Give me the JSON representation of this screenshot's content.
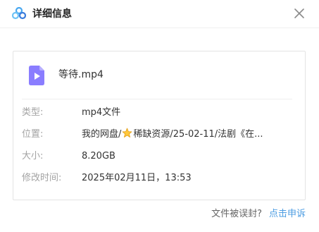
{
  "dialog": {
    "title": "详细信息",
    "logo_icon": "cloud-logo-icon",
    "close_icon": "close-icon"
  },
  "file": {
    "name": "等待.mp4",
    "icon": "video-file-icon",
    "icon_color": "#8a7dff"
  },
  "details": {
    "type_label": "类型:",
    "type_value": "mp4文件",
    "location_label": "位置:",
    "location_prefix": "我的网盘/",
    "location_icon": "star-icon",
    "location_suffix": "稀缺资源/25-02-11/法剧《在...",
    "size_label": "大小:",
    "size_value": "8.20GB",
    "modified_label": "修改时间:",
    "modified_value": "2025年02月11日，13:53"
  },
  "footer": {
    "question": "文件被误封?",
    "report_link": "点击申诉",
    "link_color": "#4b9ce2"
  }
}
